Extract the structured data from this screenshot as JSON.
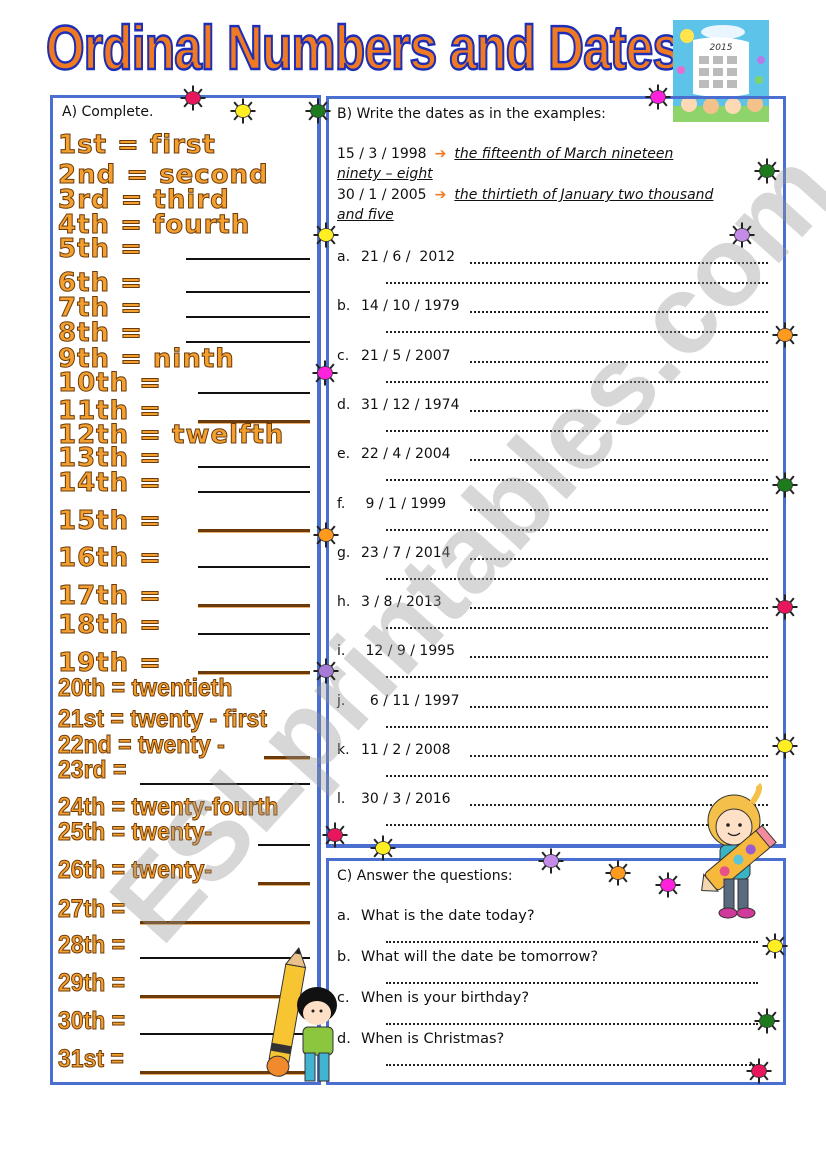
{
  "title": "Ordinal Numbers and Dates",
  "colors": {
    "title_fill": "#f07a22",
    "title_outline": "#1f2fb5",
    "box_border": "#4a6fd0",
    "ordinal_fill": "#f4a030",
    "arrow": "#f07a22"
  },
  "images": {
    "calendar_year": "2015"
  },
  "section_a": {
    "heading": "A) Complete.",
    "rows": [
      {
        "ordinal": "1st = ",
        "answer": "first"
      },
      {
        "ordinal": "2nd = ",
        "answer": "second"
      },
      {
        "ordinal": "3rd = ",
        "answer": "third"
      },
      {
        "ordinal": "4th = ",
        "answer": "fourth"
      },
      {
        "ordinal": "5th = ",
        "answer": ""
      },
      {
        "ordinal": "6th = ",
        "answer": ""
      },
      {
        "ordinal": "7th = ",
        "answer": ""
      },
      {
        "ordinal": "8th = ",
        "answer": ""
      },
      {
        "ordinal": "9th = ",
        "answer": "ninth"
      },
      {
        "ordinal": "10th = ",
        "answer": ""
      },
      {
        "ordinal": "11th = ",
        "answer": ""
      },
      {
        "ordinal": "12th = ",
        "answer": "twelfth"
      },
      {
        "ordinal": "13th = ",
        "answer": ""
      },
      {
        "ordinal": "14th = ",
        "answer": ""
      },
      {
        "ordinal": "15th = ",
        "answer": ""
      },
      {
        "ordinal": "16th = ",
        "answer": ""
      },
      {
        "ordinal": "17th = ",
        "answer": ""
      },
      {
        "ordinal": "18th = ",
        "answer": ""
      },
      {
        "ordinal": "19th = ",
        "answer": ""
      },
      {
        "ordinal": "20th = ",
        "answer": "twentieth"
      },
      {
        "ordinal": "21st = ",
        "answer": "twenty - first"
      },
      {
        "ordinal": "22nd = ",
        "answer": "twenty - "
      },
      {
        "ordinal": "23rd = ",
        "answer": ""
      },
      {
        "ordinal": "24th = ",
        "answer": "twenty-fourth"
      },
      {
        "ordinal": "25th = ",
        "answer": "twenty-"
      },
      {
        "ordinal": "26th = ",
        "answer": "twenty-"
      },
      {
        "ordinal": "27th = ",
        "answer": ""
      },
      {
        "ordinal": "28th = ",
        "answer": ""
      },
      {
        "ordinal": "29th = ",
        "answer": ""
      },
      {
        "ordinal": "30th = ",
        "answer": ""
      },
      {
        "ordinal": "31st = ",
        "answer": ""
      }
    ]
  },
  "section_b": {
    "heading": "B) Write the dates as in the examples:",
    "examples": [
      {
        "date": "15 / 3 / 1998",
        "arrow": "➔",
        "answer_line1": "the fifteenth of March nineteen",
        "answer_line2": "ninety – eight"
      },
      {
        "date": "30 / 1 / 2005",
        "arrow": "➔",
        "answer_line1": "the thirtieth of January two thousand",
        "answer_line2": "and five"
      }
    ],
    "items": [
      {
        "label": "a.",
        "date": "21 / 6 /  2012"
      },
      {
        "label": "b.",
        "date": "14 / 10 / 1979"
      },
      {
        "label": "c.",
        "date": "21 / 5 / 2007"
      },
      {
        "label": "d.",
        "date": "31 / 12 / 1974"
      },
      {
        "label": "e.",
        "date": "22 / 4 / 2004"
      },
      {
        "label": "f.",
        "date": " 9 / 1 / 1999"
      },
      {
        "label": "g.",
        "date": "23 / 7 / 2014"
      },
      {
        "label": "h.",
        "date": "3 / 8 / 2013"
      },
      {
        "label": "i.",
        "date": " 12 / 9 / 1995"
      },
      {
        "label": "j.",
        "date": "  6 / 11 / 1997"
      },
      {
        "label": "k.",
        "date": "11 / 2 / 2008"
      },
      {
        "label": "l.",
        "date": "30 / 3 / 2016"
      }
    ]
  },
  "section_c": {
    "heading": "C) Answer the questions:",
    "questions": [
      {
        "label": "a.",
        "text": "What is the date today?"
      },
      {
        "label": "b.",
        "text": "What will the date be tomorrow?"
      },
      {
        "label": "c.",
        "text": "When is your birthday?"
      },
      {
        "label": "d.",
        "text": "When is Christmas?"
      }
    ]
  },
  "watermark": "ESLprintables.com"
}
